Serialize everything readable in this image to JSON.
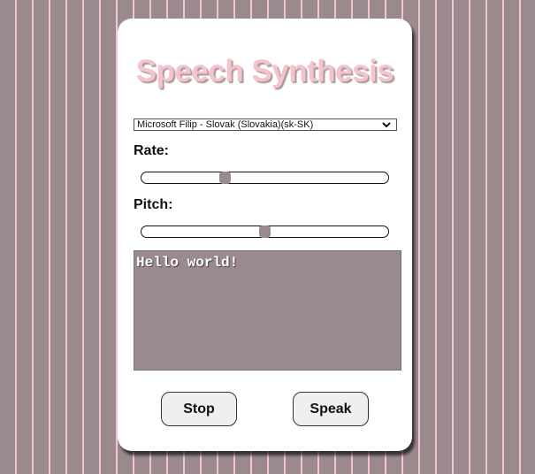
{
  "app": {
    "title": "Speech Synthesis"
  },
  "voice_select": {
    "selected": "Microsoft Filip - Slovak (Slovakia)(sk-SK)",
    "icon": "chevron-down-icon"
  },
  "rate": {
    "label": "Rate:",
    "value_fraction": 0.34
  },
  "pitch": {
    "label": "Pitch:",
    "value_fraction": 0.5
  },
  "textbox": {
    "value": "Hello world!"
  },
  "buttons": {
    "stop_label": "Stop",
    "speak_label": "Speak"
  },
  "colors": {
    "background": "#9a8a8e",
    "stripe": "#f2c7cf",
    "title": "#f4c3cc",
    "card": "#ffffff"
  }
}
